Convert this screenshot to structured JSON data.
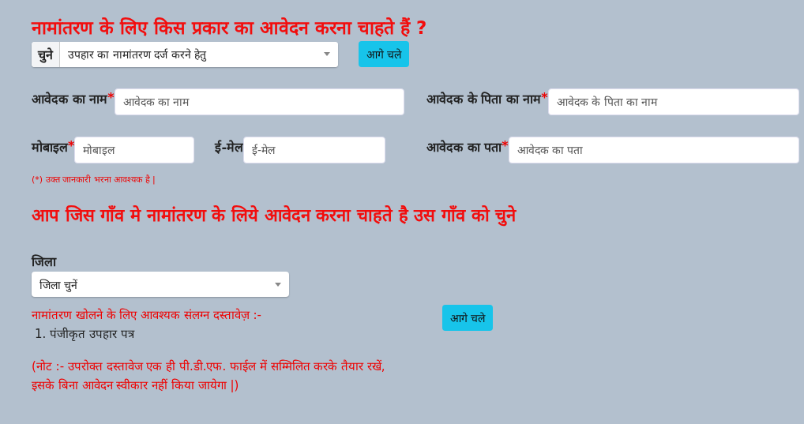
{
  "heading": "नामांतरण के लिए किस प्रकार का आवेदन करना चाहते हैं ?",
  "type_select": {
    "addon": "चुने",
    "value": "उपहार का नामांतरण दर्ज करने हेतु",
    "button": "आगे चले"
  },
  "fields": [
    {
      "label": "आवेदक का नाम",
      "required_mark": "*",
      "placeholder": "आवेदक का नाम"
    },
    {
      "label": "आवेदक के पिता का नाम",
      "required_mark": "*",
      "placeholder": "आवेदक के पिता का नाम"
    },
    {
      "label": "मोबाइल",
      "required_mark": "*",
      "placeholder": "मोबाइल"
    },
    {
      "label": "ई-मेल",
      "placeholder": "ई-मेल"
    },
    {
      "label": "आवेदक का पता",
      "required_mark": "*",
      "placeholder": "आवेदक का पता"
    }
  ],
  "required_note": "(*) उक्त जानकारी भरना आवश्यक है |",
  "village_heading": "आप जिस गाँव मे नामांतरण के लिये आवेदन करना चाहते है उस गाँव को चुने",
  "district": {
    "label": "जिला",
    "value": "जिला चुनें"
  },
  "documents": {
    "title": "नामांतरण खोलने के लिए आवश्यक संलग्न दस्तावेज़ :-",
    "items": [
      {
        "number": "1.",
        "text": "पंजीकृत उपहार पत्र"
      }
    ]
  },
  "next_button": "आगे चले",
  "note": "(नोट :- उपरोक्त दस्तावेज एक ही पी.डी.एफ. फाईल में सम्मिलित करके तैयार रखें, इसके बिना आवेदन स्वीकार नहीं किया जायेगा |)"
}
